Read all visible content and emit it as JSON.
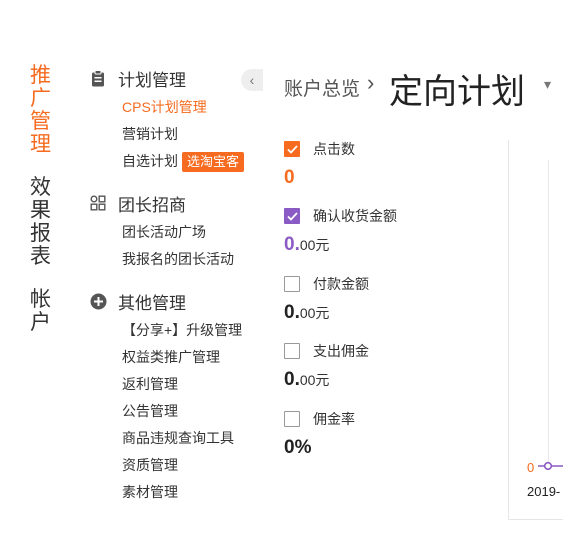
{
  "vnav": {
    "items": [
      {
        "label": "推广管理",
        "active": true
      },
      {
        "label": "效果报表",
        "active": false
      },
      {
        "label": "帐户",
        "active": false
      }
    ]
  },
  "sidebar": {
    "groups": [
      {
        "title": "计划管理",
        "icon": "clipboard-icon",
        "items": [
          {
            "label": "CPS计划管理",
            "active": true
          },
          {
            "label": "营销计划"
          },
          {
            "label": "自选计划",
            "tag": "选淘宝客"
          }
        ]
      },
      {
        "title": "团长招商",
        "icon": "grid-icon",
        "items": [
          {
            "label": "团长活动广场"
          },
          {
            "label": "我报名的团长活动"
          }
        ]
      },
      {
        "title": "其他管理",
        "icon": "plus-circle-icon",
        "items": [
          {
            "label": "【分享+】升级管理"
          },
          {
            "label": "权益类推广管理"
          },
          {
            "label": "返利管理"
          },
          {
            "label": "公告管理"
          },
          {
            "label": "商品违规查询工具"
          },
          {
            "label": "资质管理"
          },
          {
            "label": "素材管理"
          }
        ]
      }
    ],
    "collapse_glyph": "‹"
  },
  "header": {
    "breadcrumb": "账户总览",
    "separator": "›",
    "title": "定向计划",
    "title_caret": "▾"
  },
  "metrics": [
    {
      "label": "点击数",
      "checked": true,
      "color": "#f66b1f",
      "value_main": "0",
      "value_suffix": ""
    },
    {
      "label": "确认收货金额",
      "checked": true,
      "color": "#8a5bc4",
      "value_main": "0.",
      "value_suffix": "00元"
    },
    {
      "label": "付款金额",
      "checked": false,
      "color": "#222222",
      "value_main": "0.",
      "value_suffix": "00元"
    },
    {
      "label": "支出佣金",
      "checked": false,
      "color": "#222222",
      "value_main": "0.",
      "value_suffix": "00元"
    },
    {
      "label": "佣金率",
      "checked": false,
      "color": "#222222",
      "value_main": "0%",
      "value_suffix": ""
    }
  ],
  "chart_data": {
    "type": "line",
    "x": [
      "2019-"
    ],
    "series": [
      {
        "values": [
          0
        ],
        "color": "#8a5bc4"
      }
    ],
    "y_tick_labels": [
      "0"
    ]
  },
  "colors": {
    "accent": "#f66b1f",
    "purple": "#8a5bc4"
  }
}
